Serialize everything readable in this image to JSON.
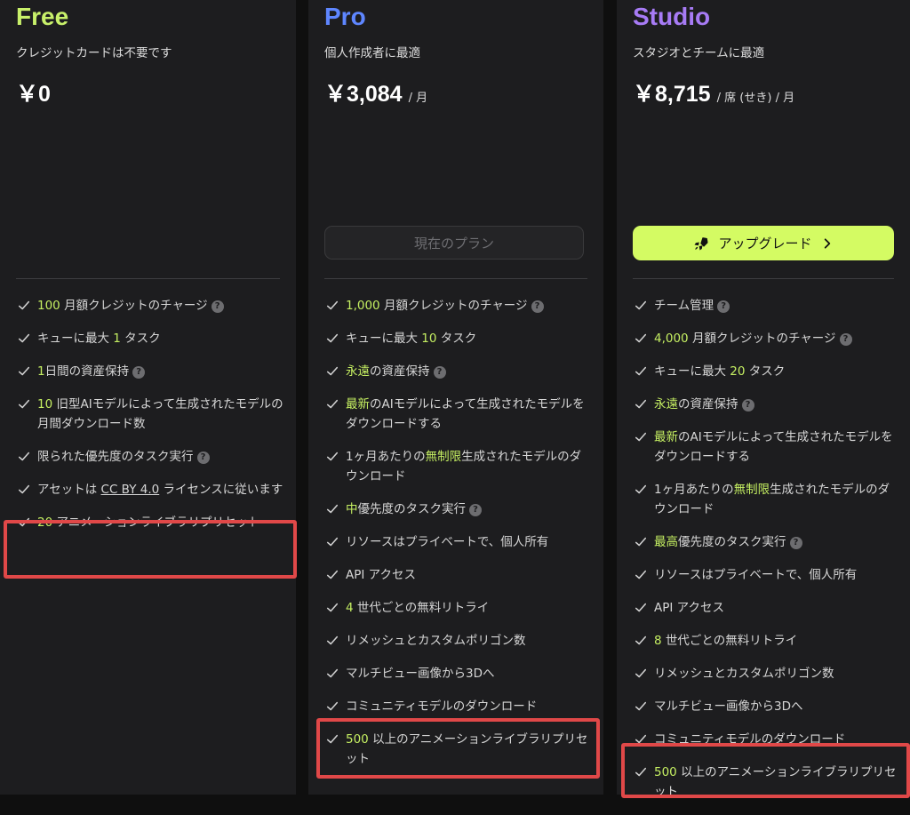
{
  "plans": {
    "free": {
      "name": "Free",
      "name_color": "#c8f06a",
      "desc": "クレジットカードは不要です",
      "price": "￥0",
      "unit": ""
    },
    "pro": {
      "name": "Pro",
      "name_color": "#5e86ff",
      "desc": "個人作成者に最適",
      "price": "￥3,084",
      "unit": "/ 月",
      "button": "現在のプラン"
    },
    "studio": {
      "name": "Studio",
      "name_color": "#a77bf5",
      "desc": "スタジオとチームに最適",
      "price": "￥8,715",
      "unit": "/ 席 (せき) / 月",
      "button": "アップグレード"
    }
  },
  "free_features": [
    {
      "hl": "100",
      "text": " 月額クレジットのチャージ",
      "help": true
    },
    {
      "pre": "キューに最大 ",
      "hl": "1",
      "text": " タスク"
    },
    {
      "hl": "1",
      "text": "日間の資産保持",
      "help": true
    },
    {
      "hl": "10",
      "text": " 旧型AIモデルによって生成されたモデルの月間ダウンロード数"
    },
    {
      "text": "限られた優先度のタスク実行",
      "help": true
    },
    {
      "pre": "アセットは ",
      "link": "CC BY 4.0",
      "text": " ライセンスに従います"
    },
    {
      "hl": "20",
      "text": " アニメーションライブラリプリセット"
    }
  ],
  "pro_features": [
    {
      "hl": "1,000",
      "text": " 月額クレジットのチャージ",
      "help": true
    },
    {
      "pre": "キューに最大 ",
      "hl": "10",
      "text": " タスク"
    },
    {
      "hl": "永遠",
      "text": "の資産保持",
      "help": true
    },
    {
      "hl": "最新",
      "text": "のAIモデルによって生成されたモデルをダウンロードする"
    },
    {
      "pre": "1ヶ月あたりの",
      "hl": "無制限",
      "text": "生成されたモデルのダウンロード"
    },
    {
      "hl": "中",
      "text": "優先度のタスク実行",
      "help": true
    },
    {
      "text": "リソースはプライベートで、個人所有"
    },
    {
      "text": "API アクセス"
    },
    {
      "hl": "4",
      "text": " 世代ごとの無料リトライ"
    },
    {
      "text": "リメッシュとカスタムポリゴン数"
    },
    {
      "text": "マルチビュー画像から3Dへ"
    },
    {
      "text": "コミュニティモデルのダウンロード"
    },
    {
      "hl": "500",
      "text": " 以上のアニメーションライブラリプリセット"
    }
  ],
  "studio_features": [
    {
      "text": "チーム管理",
      "help": true
    },
    {
      "hl": "4,000",
      "text": " 月額クレジットのチャージ",
      "help": true
    },
    {
      "pre": "キューに最大 ",
      "hl": "20",
      "text": " タスク"
    },
    {
      "hl": "永遠",
      "text": "の資産保持",
      "help": true
    },
    {
      "hl": "最新",
      "text": "のAIモデルによって生成されたモデルをダウンロードする"
    },
    {
      "pre": "1ヶ月あたりの",
      "hl": "無制限",
      "text": "生成されたモデルのダウンロード"
    },
    {
      "hl": "最高",
      "text": "優先度のタスク実行",
      "help": true
    },
    {
      "text": "リソースはプライベートで、個人所有"
    },
    {
      "text": "API アクセス"
    },
    {
      "hl": "8",
      "text": " 世代ごとの無料リトライ"
    },
    {
      "text": "リメッシュとカスタムポリゴン数"
    },
    {
      "text": "マルチビュー画像から3Dへ"
    },
    {
      "text": "コミュニティモデルのダウンロード"
    },
    {
      "hl": "500",
      "text": " 以上のアニメーションライブラリプリセット"
    }
  ],
  "colors": {
    "highlight": "#c5ef62",
    "upgrade_bg": "#d4fb63",
    "annotation": "#e04848"
  }
}
